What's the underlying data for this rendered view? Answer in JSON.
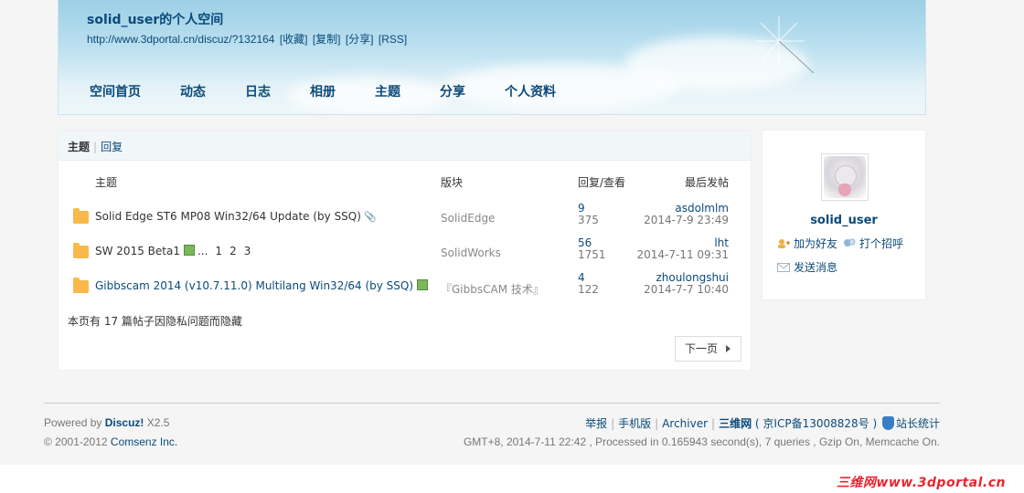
{
  "header": {
    "space_title": "solid_user的个人空间",
    "space_url": "http://www.3dportal.cn/discuz/?132164",
    "link_favorite": "[收藏]",
    "link_copy": "[复制]",
    "link_share": "[分享]",
    "link_rss": "[RSS]",
    "nav": [
      "空间首页",
      "动态",
      "日志",
      "相册",
      "主题",
      "分享",
      "个人资料"
    ]
  },
  "main": {
    "tab_current": "主题",
    "tab_reply": "回复",
    "columns": {
      "subject": "主题",
      "forum": "版块",
      "stats": "回复/查看",
      "last": "最后发帖"
    },
    "rows": [
      {
        "subject": "Solid Edge ST6 MP08 Win32/64 Update (by SSQ)",
        "forum": "SolidEdge",
        "replies": "9",
        "views": "375",
        "last_user": "asdolmlm",
        "last_time": "2014-7-9 23:49"
      },
      {
        "subject": "SW 2015 Beta1",
        "pages_ellipsis": "...",
        "pages": [
          "1",
          "2",
          "3"
        ],
        "forum": "SolidWorks",
        "replies": "56",
        "views": "1751",
        "last_user": "lht",
        "last_time": "2014-7-11 09:31"
      },
      {
        "subject": "Gibbscam 2014 (v10.7.11.0) Multilang Win32/64 (by SSQ)",
        "forum": "『GibbsCAM 技术』",
        "replies": "4",
        "views": "122",
        "last_user": "zhoulongshui",
        "last_time": "2014-7-7 10:40"
      }
    ],
    "hidden_note": "本页有 17 篇帖子因隐私问题而隐藏",
    "next_page": "下一页"
  },
  "profile": {
    "username": "solid_user",
    "add_friend": "加为好友",
    "poke": "打个招呼",
    "send_message": "发送消息"
  },
  "footer": {
    "powered_prefix": "Powered by",
    "powered_brand": "Discuz!",
    "powered_version": "X2.5",
    "copyright_prefix": "© 2001-2012",
    "copyright_company": "Comsenz Inc.",
    "links": [
      "举报",
      "手机版",
      "Archiver"
    ],
    "site_name": "三维网",
    "icp": "( 京ICP备13008828号 )",
    "stats": "站长统计",
    "gmt_line": "GMT+8, 2014-7-11 22:42 , Processed in 0.165943 second(s), 7 queries , Gzip On, Memcache On."
  },
  "watermark": "三维网www.3dportal.cn",
  "colors": {
    "link": "#0b4a7a",
    "folder": "#f8b94a",
    "watermark": "#e8262f"
  }
}
